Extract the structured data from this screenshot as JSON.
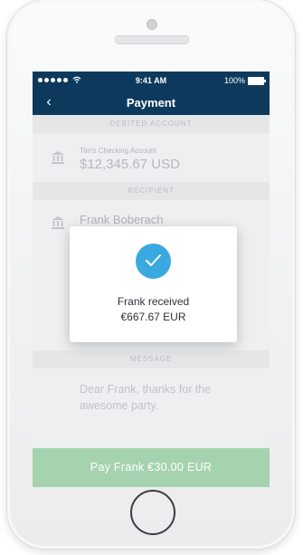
{
  "status_bar": {
    "time": "9:41 AM",
    "battery": "100%"
  },
  "nav": {
    "title": "Payment",
    "back_icon": "chevron-left-icon"
  },
  "debited_account": {
    "section_label": "DEBITED ACCOUNT",
    "account_name": "Tim's Checking Account",
    "balance": "$12,345.67 USD",
    "icon": "bank-icon"
  },
  "recipient": {
    "section_label": "RECIPIENT",
    "name": "Frank Boberach",
    "icon": "bank-icon"
  },
  "message": {
    "section_label": "MESSAGE",
    "text": "Dear Frank, thanks for the awesome party."
  },
  "pay_button": {
    "label": "Pay Frank €30.00 EUR"
  },
  "modal": {
    "icon": "check-icon",
    "line1": "Frank received",
    "line2": "€667.67 EUR"
  },
  "colors": {
    "nav_background": "#0d3a5c",
    "pay_button": "#a6d3af",
    "check_circle": "#3aa9e0"
  }
}
